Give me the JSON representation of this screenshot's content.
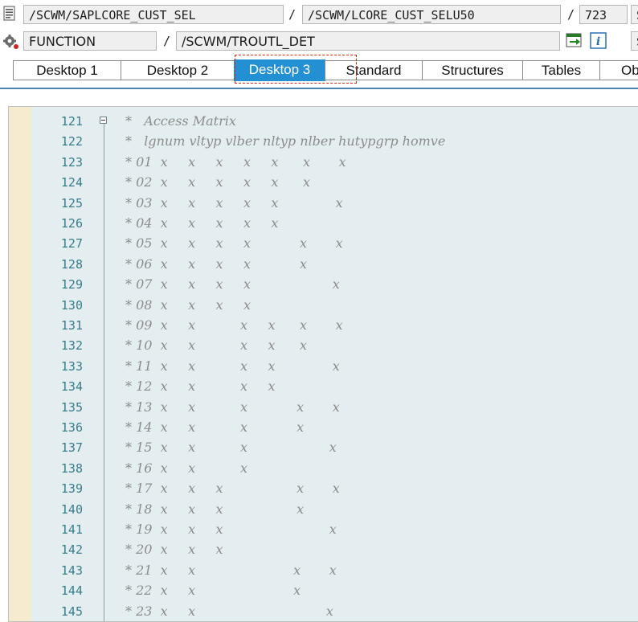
{
  "header": {
    "row1": {
      "program": "/SCWM/SAPLCORE_CUST_SEL",
      "include": "/SCWM/LCORE_CUST_SELU50",
      "line": "723",
      "trailing": "S"
    },
    "row2": {
      "type": "FUNCTION",
      "name": "/SCWM/TROUTL_DET",
      "trailing": "S"
    },
    "separator": "/"
  },
  "tabs": [
    {
      "label": "Desktop 1",
      "active": false
    },
    {
      "label": "Desktop 2",
      "active": false
    },
    {
      "label": "Desktop 3",
      "active": true
    },
    {
      "label": "Standard",
      "active": false
    },
    {
      "label": "Structures",
      "active": false
    },
    {
      "label": "Tables",
      "active": false
    },
    {
      "label": "Ob",
      "active": false
    }
  ],
  "editor": {
    "lines": [
      {
        "num": "121",
        "text": "*   Access Matrix"
      },
      {
        "num": "122",
        "text": "*   lgnum vltyp vlber nltyp nlber hutypgrp homve"
      },
      {
        "num": "123",
        "text": "* 01  x     x     x     x     x      x       x"
      },
      {
        "num": "124",
        "text": "* 02  x     x     x     x     x      x"
      },
      {
        "num": "125",
        "text": "* 03  x     x     x     x     x              x"
      },
      {
        "num": "126",
        "text": "* 04  x     x     x     x     x"
      },
      {
        "num": "127",
        "text": "* 05  x     x     x     x            x       x"
      },
      {
        "num": "128",
        "text": "* 06  x     x     x     x            x"
      },
      {
        "num": "129",
        "text": "* 07  x     x     x     x                    x"
      },
      {
        "num": "130",
        "text": "* 08  x     x     x     x"
      },
      {
        "num": "131",
        "text": "* 09  x     x           x     x      x       x"
      },
      {
        "num": "132",
        "text": "* 10  x     x           x     x      x"
      },
      {
        "num": "133",
        "text": "* 11  x     x           x     x              x"
      },
      {
        "num": "134",
        "text": "* 12  x     x           x     x"
      },
      {
        "num": "135",
        "text": "* 13  x     x           x            x       x"
      },
      {
        "num": "136",
        "text": "* 14  x     x           x            x"
      },
      {
        "num": "137",
        "text": "* 15  x     x           x                    x"
      },
      {
        "num": "138",
        "text": "* 16  x     x           x"
      },
      {
        "num": "139",
        "text": "* 17  x     x     x                  x       x"
      },
      {
        "num": "140",
        "text": "* 18  x     x     x                  x"
      },
      {
        "num": "141",
        "text": "* 19  x     x     x                          x"
      },
      {
        "num": "142",
        "text": "* 20  x     x     x"
      },
      {
        "num": "143",
        "text": "* 21  x     x                        x       x"
      },
      {
        "num": "144",
        "text": "* 22  x     x                        x"
      },
      {
        "num": "145",
        "text": "* 23  x     x                                x"
      }
    ]
  }
}
